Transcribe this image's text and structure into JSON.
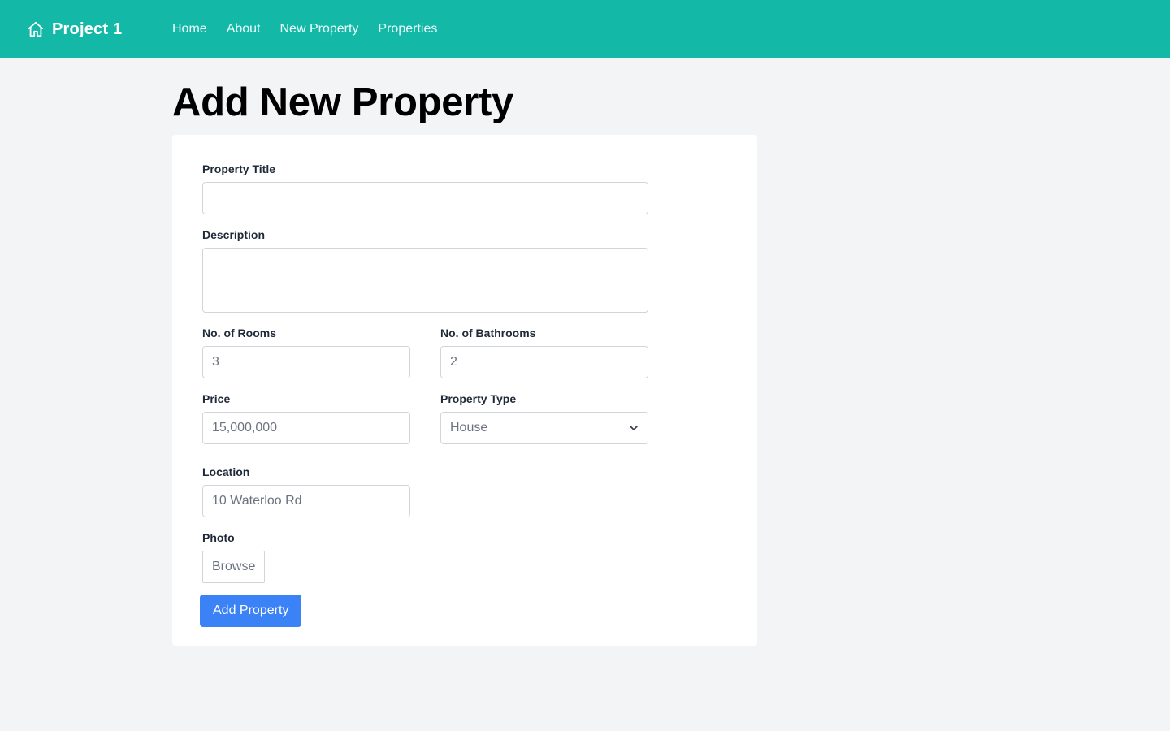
{
  "navbar": {
    "brand": "Project 1",
    "brand_icon": "home-icon",
    "links": [
      "Home",
      "About",
      "New Property",
      "Properties"
    ],
    "background": "#14b8a6"
  },
  "page": {
    "title": "Add New Property"
  },
  "form": {
    "title_label": "Property Title",
    "title_value": "",
    "description_label": "Description",
    "description_value": "",
    "rooms_label": "No. of Rooms",
    "rooms_placeholder": "3",
    "bathrooms_label": "No. of Bathrooms",
    "bathrooms_placeholder": "2",
    "price_label": "Price",
    "price_placeholder": "15,000,000",
    "type_label": "Property Type",
    "type_selected": "House",
    "location_label": "Location",
    "location_placeholder": "10 Waterloo Rd",
    "photo_label": "Photo",
    "photo_button": "Browse",
    "submit_label": "Add Property",
    "submit_color": "#3b82f6"
  }
}
